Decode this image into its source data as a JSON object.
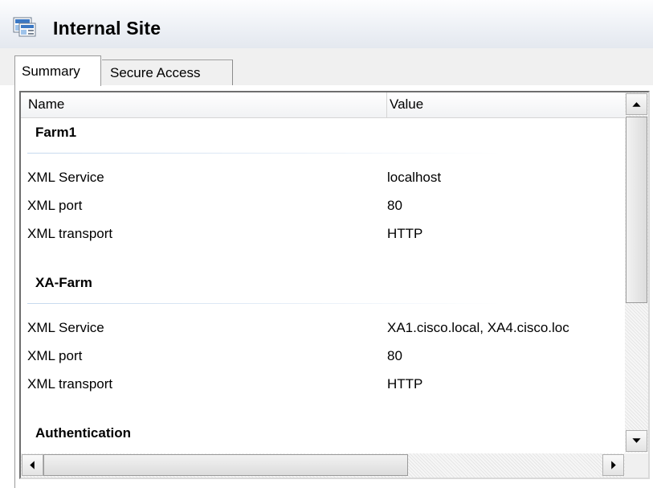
{
  "window": {
    "title": "Internal Site",
    "icon": "site-window-icon"
  },
  "tabs": [
    {
      "label": "Summary",
      "selected": true
    },
    {
      "label": "Secure Access",
      "selected": false
    }
  ],
  "list": {
    "columns": [
      "Name",
      "Value"
    ],
    "groups": [
      {
        "title": "Farm1",
        "rows": [
          {
            "name": "XML Service",
            "value": "localhost"
          },
          {
            "name": "XML port",
            "value": "80"
          },
          {
            "name": "XML transport",
            "value": "HTTP"
          }
        ]
      },
      {
        "title": "XA-Farm",
        "rows": [
          {
            "name": "XML Service",
            "value": "XA1.cisco.local, XA4.cisco.loc"
          },
          {
            "name": "XML port",
            "value": "80"
          },
          {
            "name": "XML transport",
            "value": "HTTP"
          }
        ]
      },
      {
        "title": "Authentication",
        "rows": []
      }
    ]
  },
  "colors": {
    "title_bg": "#eef1f6",
    "group_line": "#c6d9ee",
    "border": "#6e6e6e"
  }
}
